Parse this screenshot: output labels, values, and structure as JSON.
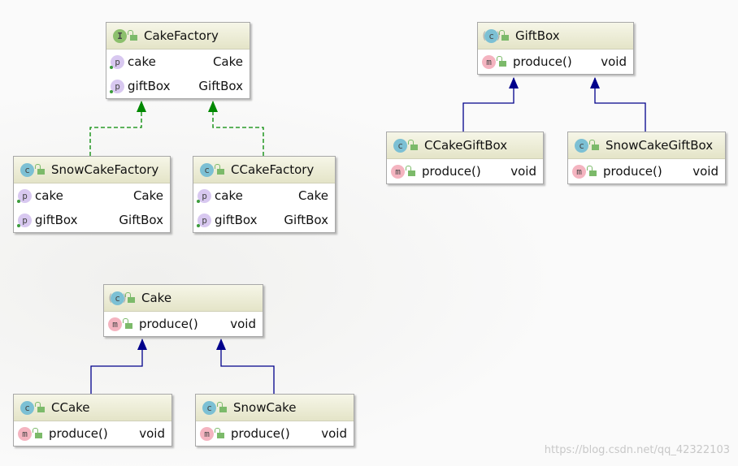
{
  "classes": {
    "cake_factory": {
      "kind": "interface",
      "icon": "I",
      "name": "CakeFactory",
      "members": [
        {
          "icon": "p",
          "name": "cake",
          "type": "Cake"
        },
        {
          "icon": "p",
          "name": "giftBox",
          "type": "GiftBox"
        }
      ]
    },
    "snow_cake_factory": {
      "kind": "class",
      "icon": "c",
      "name": "SnowCakeFactory",
      "members": [
        {
          "icon": "p",
          "name": "cake",
          "type": "Cake"
        },
        {
          "icon": "p",
          "name": "giftBox",
          "type": "GiftBox"
        }
      ]
    },
    "c_cake_factory": {
      "kind": "class",
      "icon": "c",
      "name": "CCakeFactory",
      "members": [
        {
          "icon": "p",
          "name": "cake",
          "type": "Cake"
        },
        {
          "icon": "p",
          "name": "giftBox",
          "type": "GiftBox"
        }
      ]
    },
    "gift_box": {
      "kind": "abstract",
      "icon": "c",
      "name": "GiftBox",
      "members": [
        {
          "icon": "m",
          "name": "produce()",
          "type": "void"
        }
      ]
    },
    "c_cake_gift_box": {
      "kind": "class",
      "icon": "c",
      "name": "CCakeGiftBox",
      "members": [
        {
          "icon": "m",
          "name": "produce()",
          "type": "void"
        }
      ]
    },
    "snow_cake_gift_box": {
      "kind": "class",
      "icon": "c",
      "name": "SnowCakeGiftBox",
      "members": [
        {
          "icon": "m",
          "name": "produce()",
          "type": "void"
        }
      ]
    },
    "cake": {
      "kind": "abstract",
      "icon": "c",
      "name": "Cake",
      "members": [
        {
          "icon": "m",
          "name": "produce()",
          "type": "void"
        }
      ]
    },
    "c_cake": {
      "kind": "class",
      "icon": "c",
      "name": "CCake",
      "members": [
        {
          "icon": "m",
          "name": "produce()",
          "type": "void"
        }
      ]
    },
    "snow_cake": {
      "kind": "class",
      "icon": "c",
      "name": "SnowCake",
      "members": [
        {
          "icon": "m",
          "name": "produce()",
          "type": "void"
        }
      ]
    }
  },
  "relations": [
    {
      "from": "snow_cake_factory",
      "to": "cake_factory",
      "type": "implements"
    },
    {
      "from": "c_cake_factory",
      "to": "cake_factory",
      "type": "implements"
    },
    {
      "from": "c_cake_gift_box",
      "to": "gift_box",
      "type": "extends"
    },
    {
      "from": "snow_cake_gift_box",
      "to": "gift_box",
      "type": "extends"
    },
    {
      "from": "c_cake",
      "to": "cake",
      "type": "extends"
    },
    {
      "from": "snow_cake",
      "to": "cake",
      "type": "extends"
    }
  ],
  "colors": {
    "implements": "#008800",
    "extends": "#00008b"
  },
  "watermark": "https://blog.csdn.net/qq_42322103"
}
